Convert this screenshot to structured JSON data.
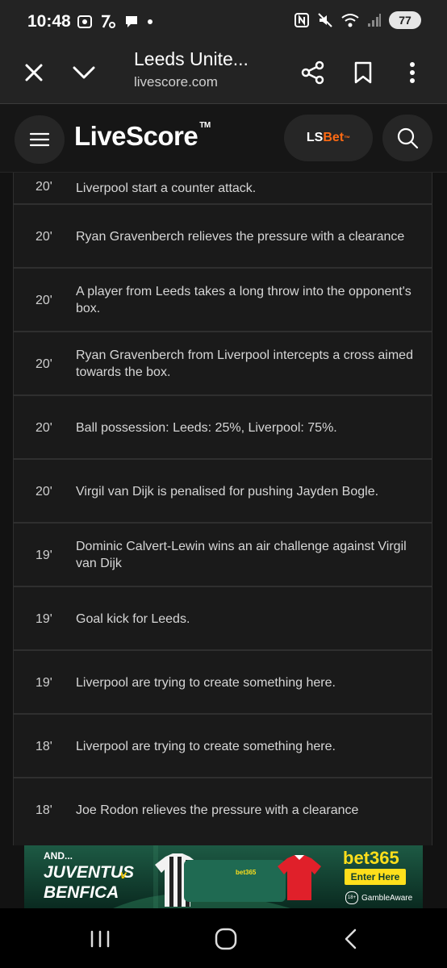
{
  "status_bar": {
    "time": "10:48",
    "battery": "77",
    "left_icons": [
      "screenshot-icon",
      "percent-app-icon",
      "chat-bubble-icon",
      "dot-icon"
    ],
    "right_icons": [
      "nfc-icon",
      "mute-icon",
      "wifi-icon",
      "signal-icon"
    ]
  },
  "browser": {
    "title": "Leeds Unite...",
    "url": "livescore.com"
  },
  "header": {
    "logo": "LiveScore",
    "logo_tm": "TM",
    "lsbet_ls": "LS",
    "lsbet_bet": "Bet",
    "lsbet_tm": "™"
  },
  "commentary": [
    {
      "minute": "20'",
      "text": "Liverpool start a counter attack."
    },
    {
      "minute": "20'",
      "text": "Ryan Gravenberch relieves the pressure with a clearance"
    },
    {
      "minute": "20'",
      "text": "A player from Leeds takes a long throw into the opponent's box."
    },
    {
      "minute": "20'",
      "text": "Ryan Gravenberch from Liverpool intercepts a cross aimed towards the box."
    },
    {
      "minute": "20'",
      "text": "Ball possession: Leeds: 25%, Liverpool: 75%."
    },
    {
      "minute": "20'",
      "text": "Virgil van Dijk is penalised for pushing Jayden Bogle."
    },
    {
      "minute": "19'",
      "text": "Dominic Calvert-Lewin wins an air challenge against Virgil van Dijk"
    },
    {
      "minute": "19'",
      "text": "Goal kick for Leeds."
    },
    {
      "minute": "19'",
      "text": "Liverpool are trying to create something here."
    },
    {
      "minute": "18'",
      "text": "Liverpool are trying to create something here."
    },
    {
      "minute": "18'",
      "text": "Joe Rodon relieves the pressure with a clearance"
    }
  ],
  "ad": {
    "and": "AND...",
    "team1": "JUVENTUS",
    "vs": "v",
    "team2": "BENFICA",
    "brand": "bet365",
    "cta": "Enter Here",
    "age": "18+",
    "gamble": "GambleAware",
    "phone_brand": "bet365"
  },
  "colors": {
    "background": "#121212",
    "row_background": "#1a1a1a",
    "accent_bet": "#ff6a13",
    "ad_green": "#0f3e2f",
    "ad_yellow": "#ffdf1b"
  }
}
